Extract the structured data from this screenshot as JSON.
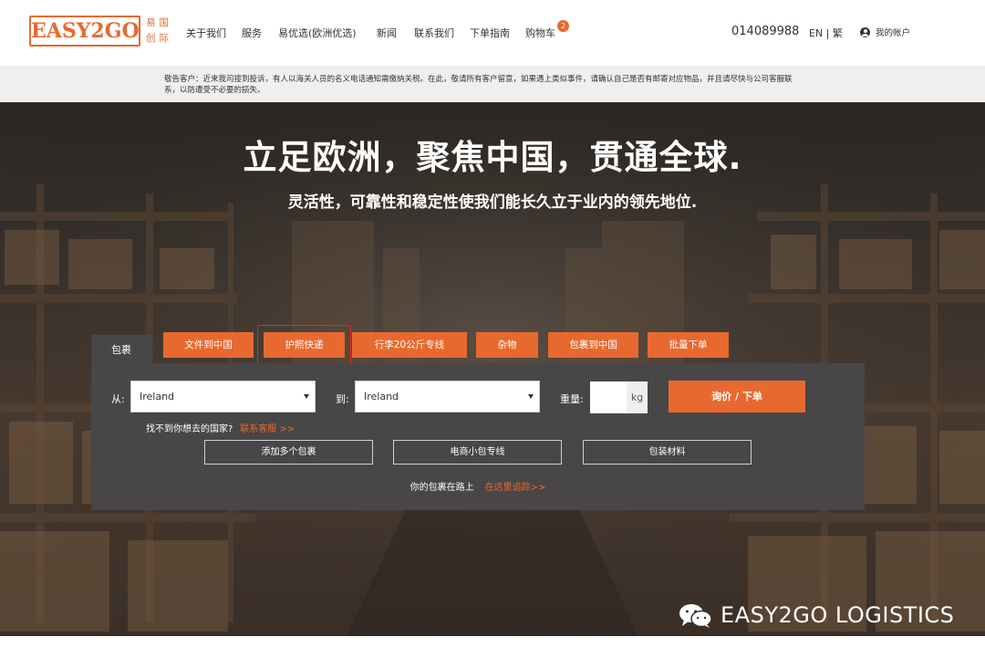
{
  "header": {
    "logo": {
      "text": "EASY2GO",
      "cn": "易国创际"
    },
    "nav": [
      {
        "label": "关于我们"
      },
      {
        "label": "服务"
      },
      {
        "label": "易优选(欧洲优选)"
      },
      {
        "label": "新闻"
      },
      {
        "label": "联系我们"
      },
      {
        "label": "下单指南"
      },
      {
        "label": "购物车",
        "badge": "2"
      }
    ],
    "phone": "014089988",
    "lang": "EN | 繁",
    "account": "我的帐户"
  },
  "notice": "敬告客户：近来我司接到投诉，有人以海关人员的名义电话通知需缴纳关税。在此，敬请所有客户留意，如果遇上类似事件，请确认自己是否有邮寄对应物品，并且请尽快与公司客服联系，以防遭受不必要的损失。",
  "hero": {
    "title": "立足欧洲，聚焦中国，贯通全球.",
    "subtitle": "灵活性，可靠性和稳定性使我们能长久立于业内的领先地位."
  },
  "tabs": {
    "active": "包裹",
    "services": [
      "文件到中国",
      "护照快递",
      "行李20公斤专线",
      "杂物",
      "包裹到中国",
      "批量下单"
    ]
  },
  "form": {
    "from_label": "从:",
    "from_value": "Ireland",
    "to_label": "到:",
    "to_value": "Ireland",
    "weight_label": "重量:",
    "weight_unit": "kg",
    "quote_button": "询价 / 下单",
    "cant_find": "找不到你想去的国家?",
    "contact_link": "联系客服 >>",
    "buttons": [
      "添加多个包裹",
      "电商小包专线",
      "包装材料"
    ],
    "track_text": "你的包裹在路上",
    "track_link": "在这里追踪>>"
  },
  "watermark": "EASY2GO LOGISTICS",
  "colors": {
    "accent": "#e8692f",
    "panel": "#484646",
    "highlight": "#e32a2a"
  }
}
